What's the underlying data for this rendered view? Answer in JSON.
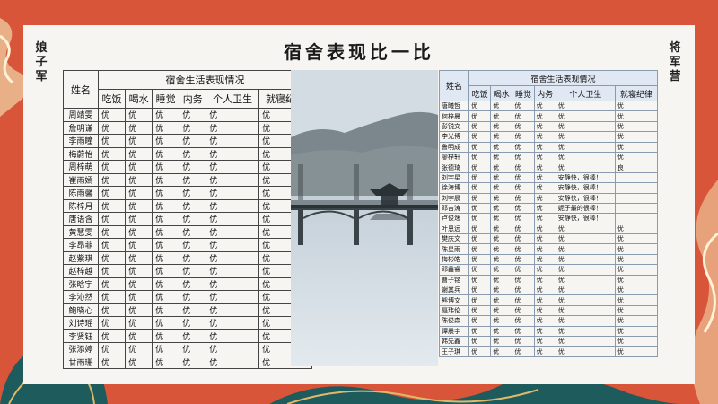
{
  "title": "宿舍表现比一比",
  "left_label": "娘子军",
  "right_label": "将军营",
  "left_table": {
    "name_header": "姓名",
    "group_header": "宿舍生活表现情况",
    "columns": [
      "吃饭",
      "喝水",
      "睡觉",
      "内务",
      "个人卫生",
      "就寝纪律"
    ],
    "rows": [
      {
        "name": "周靖雯",
        "values": [
          "优",
          "优",
          "优",
          "优",
          "优",
          "优"
        ]
      },
      {
        "name": "詹明谦",
        "values": [
          "优",
          "优",
          "优",
          "优",
          "优",
          "优"
        ]
      },
      {
        "name": "李雨瞳",
        "values": [
          "优",
          "优",
          "优",
          "优",
          "优",
          "优"
        ]
      },
      {
        "name": "梅蔚怡",
        "values": [
          "优",
          "优",
          "优",
          "优",
          "优",
          "优"
        ]
      },
      {
        "name": "周梓萌",
        "values": [
          "优",
          "优",
          "优",
          "优",
          "优",
          "优"
        ]
      },
      {
        "name": "崔雨嫣",
        "values": [
          "优",
          "优",
          "优",
          "优",
          "优",
          "优"
        ]
      },
      {
        "name": "陈雨馨",
        "values": [
          "优",
          "优",
          "优",
          "优",
          "优",
          "优"
        ]
      },
      {
        "name": "陈梓月",
        "values": [
          "优",
          "优",
          "优",
          "优",
          "优",
          "优"
        ]
      },
      {
        "name": "唐语含",
        "values": [
          "优",
          "优",
          "优",
          "优",
          "优",
          "优"
        ]
      },
      {
        "name": "黄慧雯",
        "values": [
          "优",
          "优",
          "优",
          "优",
          "优",
          "优"
        ]
      },
      {
        "name": "李昂菲",
        "values": [
          "优",
          "优",
          "优",
          "优",
          "优",
          "优"
        ]
      },
      {
        "name": "赵紫琪",
        "values": [
          "优",
          "优",
          "优",
          "优",
          "优",
          "优"
        ]
      },
      {
        "name": "赵梓越",
        "values": [
          "优",
          "优",
          "优",
          "优",
          "优",
          "优"
        ]
      },
      {
        "name": "张晗宇",
        "values": [
          "优",
          "优",
          "优",
          "优",
          "优",
          "优"
        ]
      },
      {
        "name": "李沁然",
        "values": [
          "优",
          "优",
          "优",
          "优",
          "优",
          "优"
        ]
      },
      {
        "name": "鲍晓心",
        "values": [
          "优",
          "优",
          "优",
          "优",
          "优",
          "优"
        ]
      },
      {
        "name": "刘诗瑶",
        "values": [
          "优",
          "优",
          "优",
          "优",
          "优",
          "优"
        ]
      },
      {
        "name": "李贤钰",
        "values": [
          "优",
          "优",
          "优",
          "优",
          "优",
          "优"
        ]
      },
      {
        "name": "张添婷",
        "values": [
          "优",
          "优",
          "优",
          "优",
          "优",
          "优"
        ]
      },
      {
        "name": "甘雨珊",
        "values": [
          "优",
          "优",
          "优",
          "优",
          "优",
          "优"
        ]
      }
    ]
  },
  "right_table": {
    "name_header": "姓名",
    "group_header": "宿舍生活表现情况",
    "columns": [
      "吃饭",
      "喝水",
      "睡觉",
      "内务",
      "个人卫生",
      "就寝纪律"
    ],
    "rows": [
      {
        "name": "唐曦哲",
        "values": [
          "优",
          "优",
          "优",
          "优",
          "优",
          "优"
        ]
      },
      {
        "name": "何梓晨",
        "values": [
          "优",
          "优",
          "优",
          "优",
          "优",
          "优"
        ]
      },
      {
        "name": "彭锐文",
        "values": [
          "优",
          "优",
          "优",
          "优",
          "优",
          "优"
        ]
      },
      {
        "name": "李光博",
        "values": [
          "优",
          "优",
          "优",
          "优",
          "优",
          "优"
        ]
      },
      {
        "name": "鲁明成",
        "values": [
          "优",
          "优",
          "优",
          "优",
          "优",
          "优"
        ]
      },
      {
        "name": "廖梓轩",
        "values": [
          "优",
          "优",
          "优",
          "优",
          "优",
          "优"
        ]
      },
      {
        "name": "张德琦",
        "values": [
          "优",
          "优",
          "优",
          "优",
          "优",
          "良"
        ]
      },
      {
        "name": "刘宇星",
        "values": [
          "优",
          "优",
          "优",
          "优",
          "安静快，很棒！",
          ""
        ]
      },
      {
        "name": "徐海博",
        "values": [
          "优",
          "优",
          "优",
          "优",
          "安静快，很棒！",
          ""
        ]
      },
      {
        "name": "刘宇晨",
        "values": [
          "优",
          "优",
          "优",
          "优",
          "安静快，很棒！",
          ""
        ]
      },
      {
        "name": "邓吉涛",
        "values": [
          "优",
          "优",
          "优",
          "优",
          "妮子最的很棒！",
          ""
        ]
      },
      {
        "name": "卢俊逸",
        "values": [
          "优",
          "优",
          "优",
          "优",
          "安静快，很棒！",
          ""
        ]
      },
      {
        "name": "叶恩远",
        "values": [
          "优",
          "优",
          "优",
          "优",
          "优",
          "优"
        ]
      },
      {
        "name": "樊庆文",
        "values": [
          "优",
          "优",
          "优",
          "优",
          "优",
          "优"
        ]
      },
      {
        "name": "陈星雨",
        "values": [
          "优",
          "优",
          "优",
          "优",
          "优",
          "优"
        ]
      },
      {
        "name": "梅彬皓",
        "values": [
          "优",
          "优",
          "优",
          "优",
          "优",
          "优"
        ]
      },
      {
        "name": "邓鑫睿",
        "values": [
          "优",
          "优",
          "优",
          "优",
          "优",
          "优"
        ]
      },
      {
        "name": "曹子铭",
        "values": [
          "优",
          "优",
          "优",
          "优",
          "优",
          "优"
        ]
      },
      {
        "name": "谢其兵",
        "values": [
          "优",
          "优",
          "优",
          "优",
          "优",
          "优"
        ]
      },
      {
        "name": "熊博文",
        "values": [
          "优",
          "优",
          "优",
          "优",
          "优",
          "优"
        ]
      },
      {
        "name": "聂玮伦",
        "values": [
          "优",
          "优",
          "优",
          "优",
          "优",
          "优"
        ]
      },
      {
        "name": "陈俊森",
        "values": [
          "优",
          "优",
          "优",
          "优",
          "优",
          "优"
        ]
      },
      {
        "name": "谭晨宇",
        "values": [
          "优",
          "优",
          "优",
          "优",
          "优",
          "优"
        ]
      },
      {
        "name": "韩先鑫",
        "values": [
          "优",
          "优",
          "优",
          "优",
          "优",
          "优"
        ]
      },
      {
        "name": "王子琪",
        "values": [
          "优",
          "优",
          "优",
          "优",
          "优",
          "优"
        ]
      }
    ]
  },
  "colors": {
    "background": "#d9553a",
    "panel": "#f6f5f2",
    "right_header": "#dfe8f3"
  }
}
